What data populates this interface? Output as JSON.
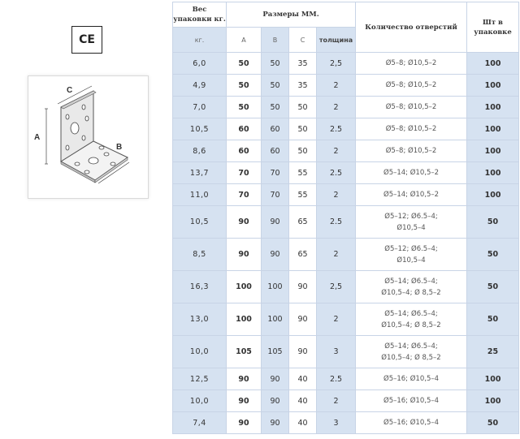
{
  "ce_mark": "CE",
  "diagram": {
    "label_a": "A",
    "label_b": "B",
    "label_c": "C"
  },
  "headers": {
    "weight": "Вес упаковки кг.",
    "weight_unit": "кг.",
    "dims": "Размеры ММ.",
    "col_a": "A",
    "col_b": "B",
    "col_c": "C",
    "col_t": "толщина",
    "holes": "Количество отверстий",
    "pcs": "Шт в упаковке"
  },
  "rows": [
    {
      "w": "6,0",
      "a": "50",
      "b": "50",
      "c": "35",
      "t": "2,5",
      "h": "Ø5–8; Ø10,5–2",
      "p": "100"
    },
    {
      "w": "4,9",
      "a": "50",
      "b": "50",
      "c": "35",
      "t": "2",
      "h": "Ø5–8; Ø10,5–2",
      "p": "100"
    },
    {
      "w": "7,0",
      "a": "50",
      "b": "50",
      "c": "50",
      "t": "2",
      "h": "Ø5–8; Ø10,5–2",
      "p": "100"
    },
    {
      "w": "10,5",
      "a": "60",
      "b": "60",
      "c": "50",
      "t": "2.5",
      "h": "Ø5–8; Ø10,5–2",
      "p": "100"
    },
    {
      "w": "8,6",
      "a": "60",
      "b": "60",
      "c": "50",
      "t": "2",
      "h": "Ø5–8; Ø10,5–2",
      "p": "100"
    },
    {
      "w": "13,7",
      "a": "70",
      "b": "70",
      "c": "55",
      "t": "2.5",
      "h": "Ø5–14; Ø10,5–2",
      "p": "100"
    },
    {
      "w": "11,0",
      "a": "70",
      "b": "70",
      "c": "55",
      "t": "2",
      "h": "Ø5–14; Ø10,5–2",
      "p": "100"
    },
    {
      "w": "10,5",
      "a": "90",
      "b": "90",
      "c": "65",
      "t": "2.5",
      "h": "Ø5–12; Ø6.5–4;",
      "h2": "Ø10,5–4",
      "p": "50"
    },
    {
      "w": "8,5",
      "a": "90",
      "b": "90",
      "c": "65",
      "t": "2",
      "h": "Ø5–12; Ø6.5–4;",
      "h2": "Ø10,5–4",
      "p": "50"
    },
    {
      "w": "16,3",
      "a": "100",
      "b": "100",
      "c": "90",
      "t": "2,5",
      "h": "Ø5–14; Ø6.5–4;",
      "h2": "Ø10,5–4; Ø 8,5–2",
      "p": "50"
    },
    {
      "w": "13,0",
      "a": "100",
      "b": "100",
      "c": "90",
      "t": "2",
      "h": "Ø5–14; Ø6.5–4;",
      "h2": "Ø10,5–4; Ø 8,5–2",
      "p": "50"
    },
    {
      "w": "10,0",
      "a": "105",
      "b": "105",
      "c": "90",
      "t": "3",
      "h": "Ø5–14; Ø6.5–4;",
      "h2": "Ø10,5–4; Ø 8,5–2",
      "p": "25"
    },
    {
      "w": "12,5",
      "a": "90",
      "b": "90",
      "c": "40",
      "t": "2.5",
      "h": "Ø5–16; Ø10,5–4",
      "p": "100"
    },
    {
      "w": "10,0",
      "a": "90",
      "b": "90",
      "c": "40",
      "t": "2",
      "h": "Ø5–16; Ø10,5–4",
      "p": "100"
    },
    {
      "w": "7,4",
      "a": "90",
      "b": "90",
      "c": "40",
      "t": "3",
      "h": "Ø5–16; Ø10,5–4",
      "p": "50"
    }
  ]
}
